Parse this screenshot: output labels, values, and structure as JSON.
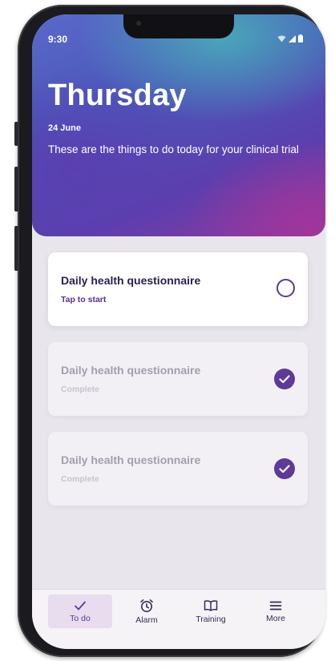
{
  "status_bar": {
    "time": "9:30",
    "icons": [
      "wifi-icon",
      "signal-icon",
      "battery-icon"
    ]
  },
  "header": {
    "day": "Thursday",
    "date": "24 June",
    "intro": "These are the things to do today for your clinical trial"
  },
  "tasks": [
    {
      "title": "Daily health questionnaire",
      "status": "Tap to start",
      "completed": false
    },
    {
      "title": "Daily health questionnaire",
      "status": "Complete",
      "completed": true
    },
    {
      "title": "Daily health questionnaire",
      "status": "Complete",
      "completed": true
    }
  ],
  "tabbar": {
    "items": [
      {
        "label": "To do",
        "icon": "check-icon",
        "active": true
      },
      {
        "label": "Alarm",
        "icon": "alarm-clock-icon",
        "active": false
      },
      {
        "label": "Training",
        "icon": "book-icon",
        "active": false
      },
      {
        "label": "More",
        "icon": "menu-icon",
        "active": false
      }
    ]
  },
  "colors": {
    "accent": "#5e3a96",
    "card_title": "#2b1f49",
    "muted_text": "#a29fae",
    "active_tab_bg": "#e8dcef"
  }
}
